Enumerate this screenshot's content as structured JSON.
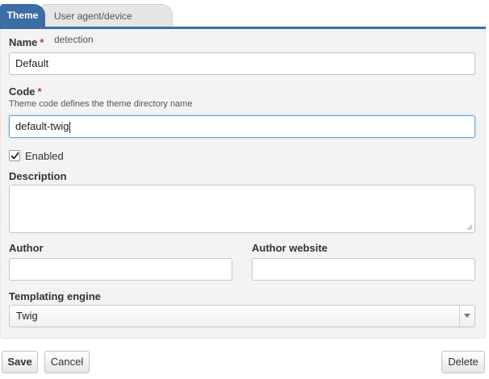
{
  "tabs": [
    {
      "label": "Theme",
      "active": true
    },
    {
      "label": "User agent/device detection",
      "active": false
    }
  ],
  "form": {
    "name": {
      "label": "Name",
      "required_mark": "*",
      "value": "Default"
    },
    "code": {
      "label": "Code",
      "required_mark": "*",
      "hint": "Theme code defines the theme directory name",
      "value": "default-twig"
    },
    "enabled": {
      "label": "Enabled",
      "checked": true
    },
    "description": {
      "label": "Description",
      "value": ""
    },
    "author": {
      "label": "Author",
      "value": ""
    },
    "author_website": {
      "label": "Author website",
      "value": ""
    },
    "templating_engine": {
      "label": "Templating engine",
      "value": "Twig"
    }
  },
  "buttons": {
    "save": "Save",
    "cancel": "Cancel",
    "delete": "Delete"
  },
  "colors": {
    "accent": "#3b6ea5",
    "required": "#c0392b",
    "panel_bg": "#f3f3f3",
    "focus_border": "#5aa7d8"
  }
}
